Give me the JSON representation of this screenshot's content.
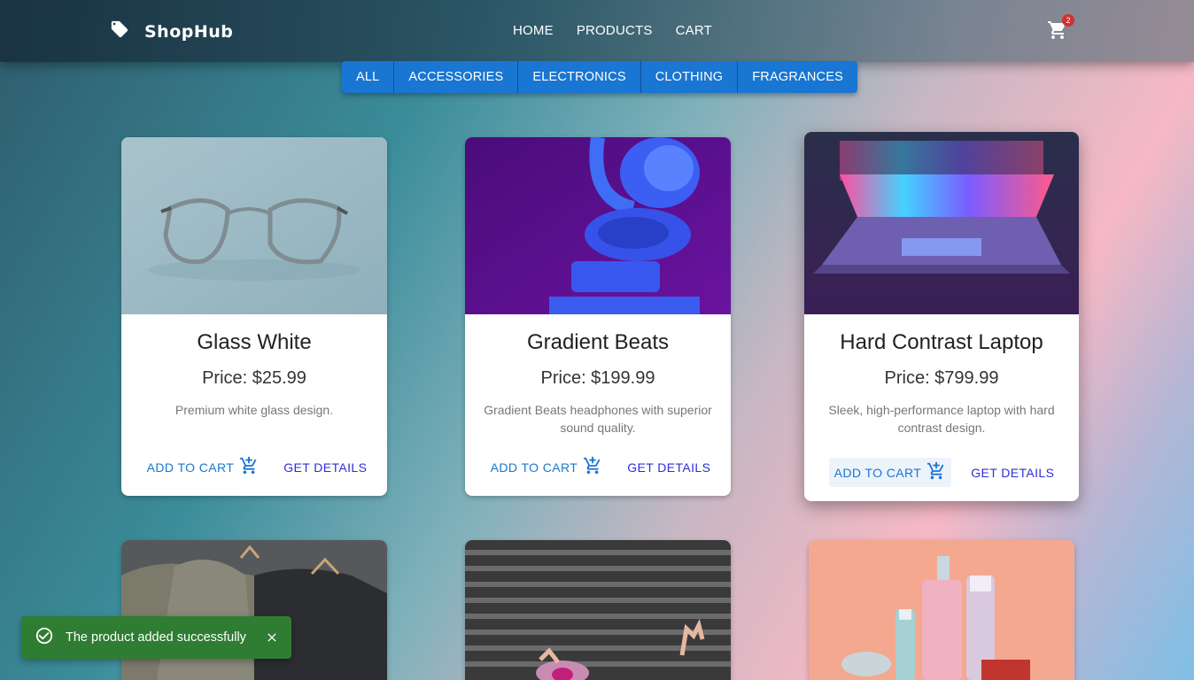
{
  "brand": {
    "name": "ShopHub",
    "icon": "tag-icon"
  },
  "nav": {
    "links": [
      "HOME",
      "PRODUCTS",
      "CART"
    ]
  },
  "cart": {
    "icon": "cart-icon",
    "count": "2"
  },
  "filters": [
    "ALL",
    "ACCESSORIES",
    "ELECTRONICS",
    "CLOTHING",
    "FRAGRANCES"
  ],
  "products": [
    {
      "title": "Glass White",
      "price": "Price: $25.99",
      "description": "Premium white glass design.",
      "add_label": "ADD TO CART",
      "details_label": "GET DETAILS"
    },
    {
      "title": "Gradient Beats",
      "price": "Price: $199.99",
      "description": "Gradient Beats headphones with superior sound quality.",
      "add_label": "ADD TO CART",
      "details_label": "GET DETAILS"
    },
    {
      "title": "Hard Contrast Laptop",
      "price": "Price: $799.99",
      "description": "Sleek, high-performance laptop with hard contrast design.",
      "add_label": "ADD TO CART",
      "details_label": "GET DETAILS"
    }
  ],
  "snackbar": {
    "message": "The product added successfully",
    "icon": "check-circle-icon"
  },
  "colors": {
    "primary": "#1976d2",
    "success": "#2e7d32",
    "badge": "#d32f2f",
    "details": "#2e2ed8"
  }
}
